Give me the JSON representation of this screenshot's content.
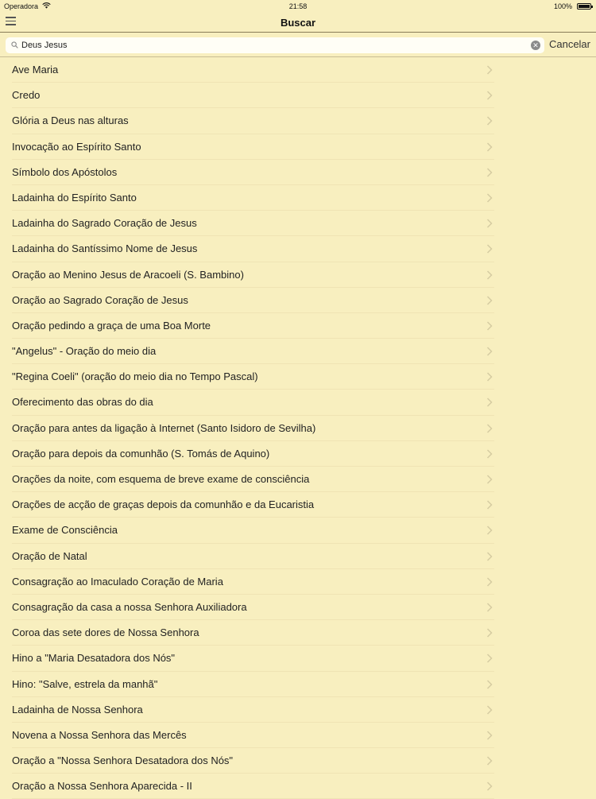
{
  "status_bar": {
    "carrier": "Operadora",
    "time": "21:58",
    "battery": "100%",
    "battery_level": 1.0
  },
  "nav": {
    "title": "Buscar",
    "menu_icon": "hamburger-menu-icon"
  },
  "search": {
    "value": "Deus Jesus",
    "placeholder": "",
    "cancel_label": "Cancelar",
    "clear_icon": "clear-icon",
    "search_icon": "search-icon"
  },
  "results": [
    "Ave Maria",
    "Credo",
    "Glória a Deus nas alturas",
    "Invocação ao Espírito Santo",
    "Símbolo dos Apóstolos",
    "Ladainha do Espírito Santo",
    "Ladainha do Sagrado Coração de Jesus",
    "Ladainha do Santíssimo Nome de Jesus",
    "Oração ao Menino Jesus de Aracoeli (S. Bambino)",
    "Oração ao Sagrado Coração de Jesus",
    "Oração pedindo a graça de uma Boa Morte",
    "\"Angelus\" - Oração do meio dia",
    "\"Regina Coeli\" (oração do meio dia no Tempo Pascal)",
    "Oferecimento das obras do dia",
    "Oração para antes da ligação à Internet (Santo Isidoro de Sevilha)",
    "Oração para depois da comunhão (S. Tomás de Aquino)",
    "Orações da noite, com esquema de breve exame de consciência",
    "Orações de acção de graças depois da comunhão e da Eucaristia",
    "Exame de Consciência",
    "Oração de Natal",
    "Consagração ao Imaculado Coração de Maria",
    "Consagração da casa a nossa Senhora Auxiliadora",
    "Coroa das sete dores de Nossa Senhora",
    "Hino a \"Maria Desatadora dos Nós\"",
    "Hino: \"Salve, estrela da manhã\"",
    "Ladainha de Nossa Senhora",
    "Novena a Nossa Senhora das Mercês",
    "Oração a \"Nossa Senhora Desatadora dos Nós\"",
    "Oração a Nossa Senhora Aparecida - II"
  ],
  "colors": {
    "background": "#f8efbf",
    "separator": "#efe4b4",
    "text": "#222222"
  }
}
